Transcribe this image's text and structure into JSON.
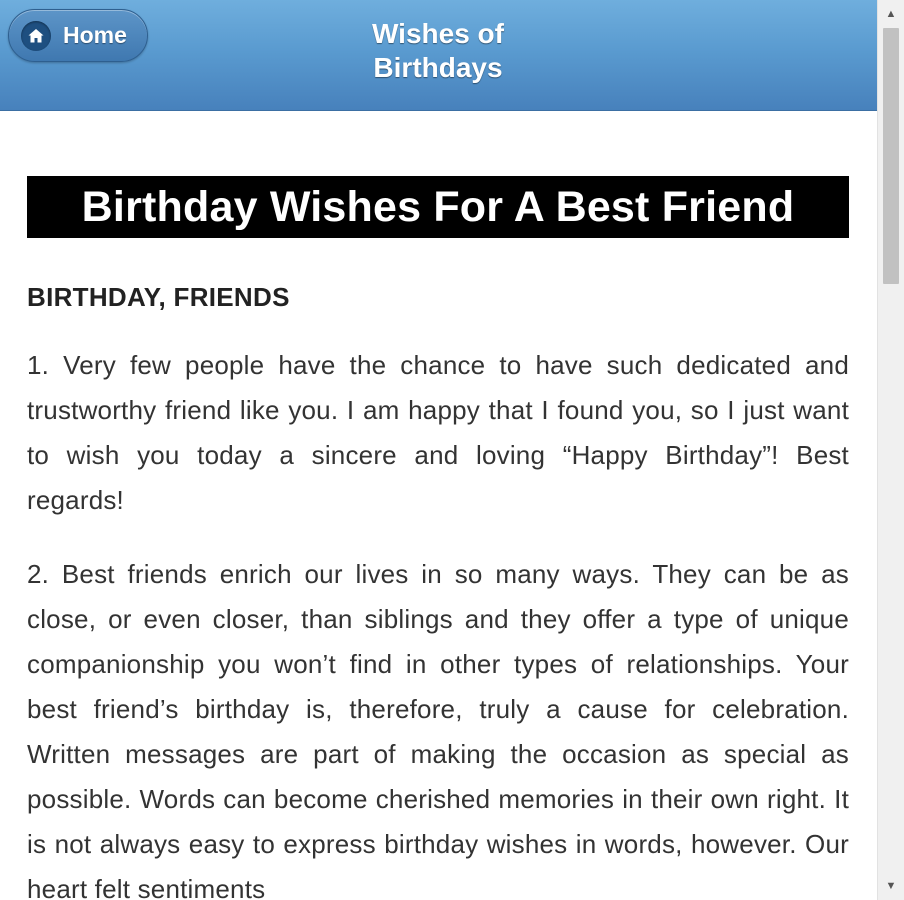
{
  "header": {
    "home_label": "Home",
    "title_line1": "Wishes of",
    "title_line2": "Birthdays",
    "home_icon": "home-icon"
  },
  "article": {
    "title": "Birthday Wishes For A Best Friend",
    "category": "BIRTHDAY, FRIENDS",
    "wishes": [
      "1. Very few people have the chance to have such dedicated and trustworthy friend like you. I am happy that I found you, so I just want to wish you today a sincere and loving “Happy Birthday”! Best regards!",
      "2. Best friends enrich our lives in so many ways. They can be as close, or even closer, than siblings and they offer a type of unique companionship you won’t find in other types of relationships. Your best friend’s birthday is, therefore, truly a cause for celebration. Written messages are part of making the occasion as special as possible. Words can become cherished memories in their own right. It is not always easy to express birthday wishes in words, however. Our heart felt sentiments"
    ]
  },
  "colors": {
    "header_top": "#6faedd",
    "header_bottom": "#4781bc",
    "banner_bg": "#000000",
    "banner_text": "#ffffff",
    "body_text": "#333333"
  }
}
